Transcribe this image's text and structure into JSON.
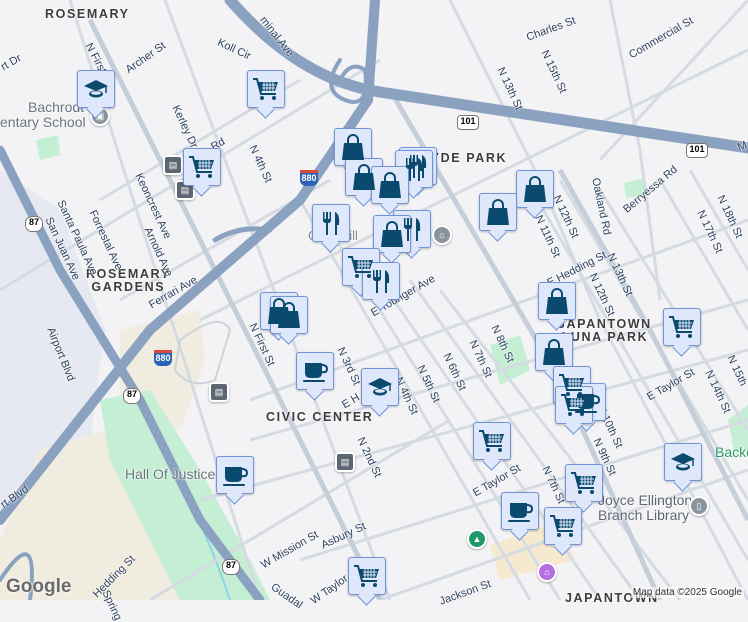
{
  "areas": {
    "rosemary": "ROSEMARY",
    "rosemary_gardens_1": "ROSEMARY",
    "rosemary_gardens_2": "GARDENS",
    "hyde_park": "HYDE PARK",
    "civic_center": "CIVIC CENTER",
    "japantown_1": "JAPANTOWN",
    "japantown_2": "LUNA PARK",
    "japantown_bottom": "JAPANTOWN"
  },
  "pois": {
    "bachrodt_1": "Bachrodt",
    "bachrodt_2": "entary School",
    "hall_of_justice": "Hall Of Justice",
    "library_1": "Joyce Ellington",
    "library_2": "Branch Library",
    "backe": "Backe",
    "goodwill": "Goodwill"
  },
  "streets": {
    "n_first_st_1": "N First St",
    "archer_st": "Archer St",
    "rt_dr": "rt Dr",
    "koll_cir": "Koll Cir",
    "terminal_ave": "minal Ave",
    "kerley_dr": "Kerley Dr",
    "rd": "Rd",
    "n_4th_st_1": "N 4th St",
    "keoncrest_ave": "Keoncrest Ave",
    "santa_paula_ave": "Santa Paula Ave",
    "forrestal_ave": "Forrestal Ave",
    "san_juan_ave": "San Juan Ave",
    "arnold_ave": "Arnold Ave",
    "ferrari_ave": "Ferrari Ave",
    "airport_blvd": "Airport Blvd",
    "airport_blvd_2": "rt Blvd",
    "n_first_st_2": "N First St",
    "n_3rd_st": "N 3rd St",
    "e_hedding_w": "E H",
    "n_4th_st_2": "N 4th St",
    "n_2nd_st": "N 2nd St",
    "w_mission_st": "W Mission St",
    "asbury_st": "Asbury St",
    "hedding_st": "Hedding St",
    "spring": "Spring",
    "guadalupe": "Guadal",
    "w_taylor": "W Taylor",
    "charles_st": "Charles St",
    "n_15th_st_1": "N 15th St",
    "n_13th_st_1": "N 13th St",
    "commercial_st": "Commercial St",
    "oakland_rd": "Oakland Rd",
    "berryessa_rd": "Berryessa Rd",
    "n_12th_st_1": "N 12th St",
    "n_11th_st": "N 11th St",
    "n_17th_st": "N 17th St",
    "n_18th_st": "N 18th St",
    "e_hedding_st": "E Hedding St",
    "n_13th_st_2": "N 13th St",
    "n_12th_st_2": "N 12th St",
    "e_younger_ave": "E Younger Ave",
    "n_8th_st": "N 8th St",
    "n_7th_st_1": "N 7th St",
    "n_6th_st": "N 6th St",
    "n_5th_st": "N 5th St",
    "e_taylor_st_1": "E Taylor St",
    "e_taylor_st_2": "E Taylor St",
    "n_10th_st": "N 10th St",
    "n_9th_st": "N 9th St",
    "n_14th_st": "N 14th St",
    "n_15th_st_2": "N 15th",
    "n_7th_st_2": "N 7th St",
    "jackson_st": "Jackson St",
    "m_label": "M"
  },
  "shields": {
    "i880_1": "880",
    "i880_2": "880",
    "us101_1": "101",
    "us101_2": "101",
    "sr87_1": "87",
    "sr87_2": "87",
    "sr87_3": "87"
  },
  "marker_icons": {
    "school": "graduation-cap-icon",
    "cart": "shopping-cart-icon",
    "bag": "shopping-bag-icon",
    "fork": "restaurant-icon",
    "cup": "coffee-cup-icon"
  },
  "colors": {
    "marker_fill": "#dfe8fb",
    "marker_border": "#6f94d8",
    "icon": "#0b4a6f",
    "highway": "#8aa2c0",
    "park": "#c4efd4"
  },
  "footer": {
    "attribution": "Map data ©2025 Google",
    "logo": "Google"
  }
}
